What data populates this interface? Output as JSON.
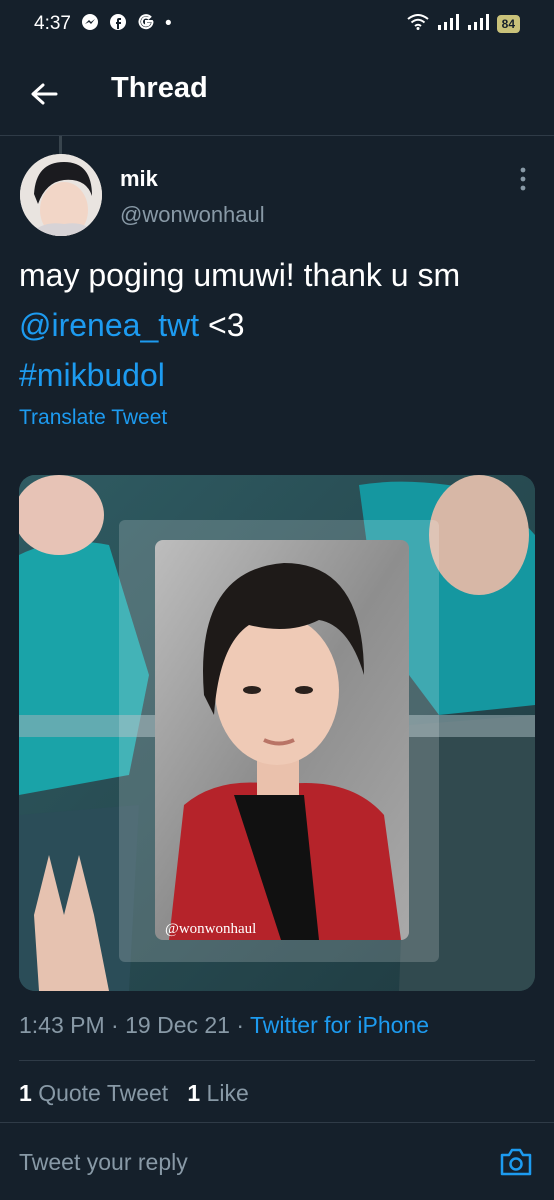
{
  "status_bar": {
    "time": "4:37",
    "app_icons": [
      "messenger-icon",
      "facebook-icon",
      "google-icon"
    ],
    "dot": "•",
    "battery": "84"
  },
  "header": {
    "title": "Thread"
  },
  "tweet": {
    "author_name": "mik",
    "author_handle": "@wonwonhaul",
    "text_part1": "may poging umuwi! thank u sm ",
    "mention": "@irenea_twt",
    "text_part2": " <3",
    "hashtag": "#mikbudol",
    "translate_label": "Translate Tweet",
    "photo_watermark": "@wonwonhaul",
    "time": "1:43 PM",
    "date": "19 Dec 21",
    "separator": "·",
    "source": "Twitter for iPhone"
  },
  "stats": {
    "quote_count": "1",
    "quote_label": "Quote Tweet",
    "like_count": "1",
    "like_label": "Like"
  },
  "reply": {
    "placeholder": "Tweet your reply"
  },
  "colors": {
    "background": "#15202b",
    "accent": "#1d9bf0",
    "secondary_text": "#8899a6"
  }
}
